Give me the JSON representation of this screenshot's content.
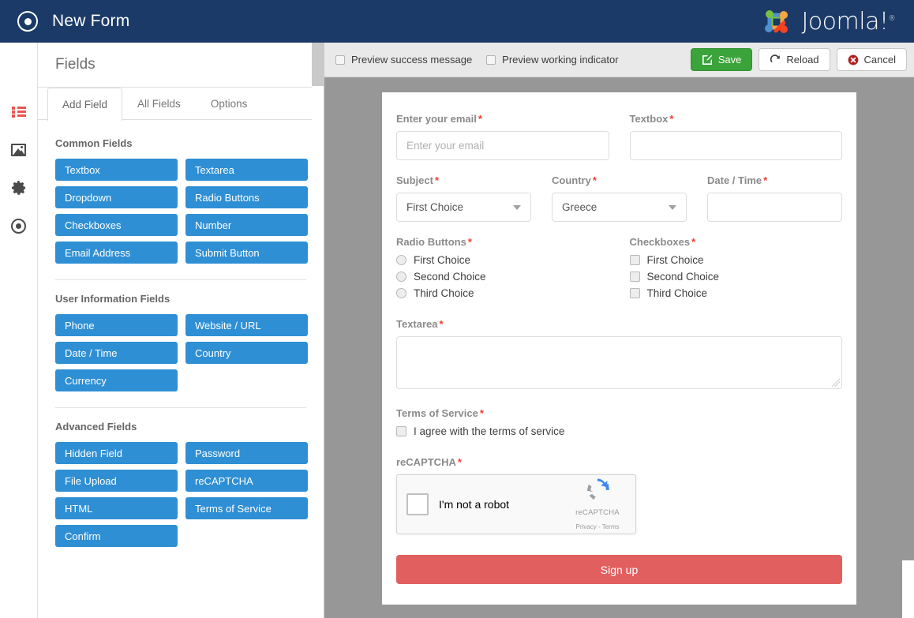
{
  "topbar": {
    "icon": "record-circle-icon",
    "title": "New Form",
    "brand": "Joomla!",
    "brand_reg": "®",
    "bg_color": "#1b3a67"
  },
  "rail": {
    "items": [
      {
        "icon": "list-icon",
        "name": "sidebar-item-fields",
        "active": true
      },
      {
        "icon": "image-icon",
        "name": "sidebar-item-media",
        "active": false
      },
      {
        "icon": "gear-icon",
        "name": "sidebar-item-settings",
        "active": false
      },
      {
        "icon": "target-icon",
        "name": "sidebar-item-target",
        "active": false
      }
    ]
  },
  "panel": {
    "heading": "Fields",
    "tabs": [
      {
        "label": "Add Field",
        "active": true
      },
      {
        "label": "All Fields",
        "active": false
      },
      {
        "label": "Options",
        "active": false
      }
    ],
    "groups": [
      {
        "title": "Common Fields",
        "buttons": [
          "Textbox",
          "Textarea",
          "Dropdown",
          "Radio Buttons",
          "Checkboxes",
          "Number",
          "Email Address",
          "Submit Button"
        ]
      },
      {
        "title": "User Information Fields",
        "buttons": [
          "Phone",
          "Website / URL",
          "Date / Time",
          "Country",
          "Currency"
        ]
      },
      {
        "title": "Advanced Fields",
        "buttons": [
          "Hidden Field",
          "Password",
          "File Upload",
          "reCAPTCHA",
          "HTML",
          "Terms of Service",
          "Confirm"
        ]
      }
    ],
    "button_color": "#2f8fd4"
  },
  "toolbar": {
    "checkboxes": [
      {
        "label": "Preview success message",
        "checked": false
      },
      {
        "label": "Preview working indicator",
        "checked": false
      }
    ],
    "save_label": "Save",
    "reload_label": "Reload",
    "cancel_label": "Cancel",
    "save_color": "#3aa33a",
    "cancel_icon_color": "#b02020"
  },
  "form": {
    "required_mark": "*",
    "fields": {
      "email": {
        "label": "Enter your email",
        "placeholder": "Enter your email",
        "value": ""
      },
      "textbox": {
        "label": "Textbox",
        "value": ""
      },
      "subject": {
        "label": "Subject",
        "value": "First Choice"
      },
      "country": {
        "label": "Country",
        "value": "Greece"
      },
      "datetime": {
        "label": "Date / Time",
        "value": ""
      },
      "radio": {
        "label": "Radio Buttons",
        "options": [
          "First Choice",
          "Second Choice",
          "Third Choice"
        ],
        "selected": null
      },
      "checkboxes": {
        "label": "Checkboxes",
        "options": [
          "First Choice",
          "Second Choice",
          "Third Choice"
        ],
        "checked": []
      },
      "textarea": {
        "label": "Textarea",
        "value": ""
      },
      "terms": {
        "label": "Terms of Service",
        "option": "I agree with the terms of service",
        "checked": false
      },
      "recaptcha": {
        "label": "reCAPTCHA",
        "text": "I'm not a robot",
        "brand": "reCAPTCHA",
        "links": "Privacy - Terms",
        "checked": false
      }
    },
    "submit_label": "Sign up",
    "submit_color": "#e1605f"
  }
}
